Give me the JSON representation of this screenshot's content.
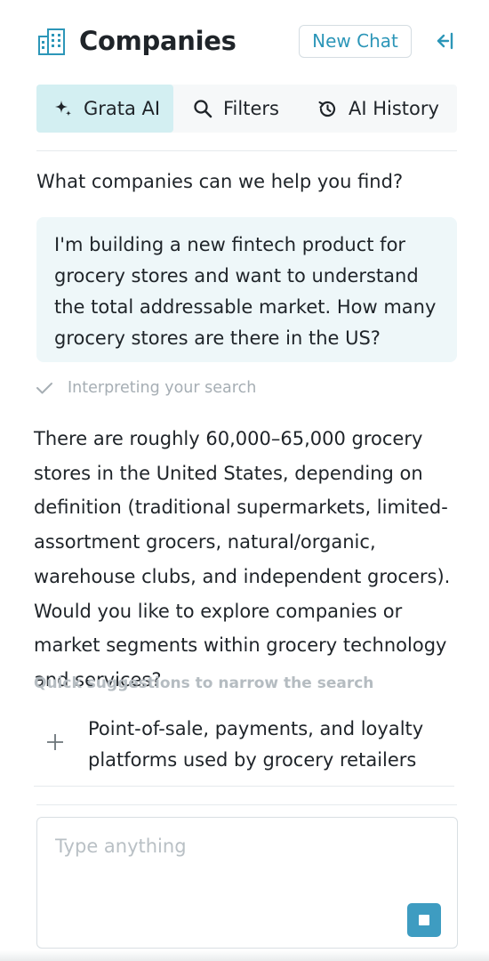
{
  "header": {
    "title": "Companies",
    "new_chat_label": "New Chat",
    "icons": [
      "building-icon",
      "collapse-panel-icon"
    ],
    "accent_color": "#2c96b8"
  },
  "tabs": [
    {
      "label": "Grata AI",
      "icon": "sparkles-icon",
      "active": true
    },
    {
      "label": "Filters",
      "icon": "search-icon",
      "active": false
    },
    {
      "label": "AI History",
      "icon": "history-icon",
      "active": false
    }
  ],
  "chat": {
    "prompt_question": "What companies can we help you find?",
    "user_message": "I'm building a new fintech product for grocery stores and want to understand the total addressable market. How many grocery stores are there in the US?",
    "status": "Interpreting your search",
    "answer": "There are roughly 60,000–65,000 grocery stores in the United States, depending on definition (traditional supermarkets, limited-assortment grocers, natural/organic, warehouse clubs, and independent grocers). Would you like to explore companies or market segments within grocery technology and services?",
    "suggestions_heading": "Quick suggestions to narrow the search",
    "suggestions": [
      {
        "label": "Point-of-sale, payments, and loyalty platforms used by grocery retailers",
        "icon": "plus-icon"
      }
    ]
  },
  "composer": {
    "placeholder": "Type anything",
    "value": "",
    "stop_icon": "stop-icon",
    "button_color": "#3e9cc1"
  }
}
